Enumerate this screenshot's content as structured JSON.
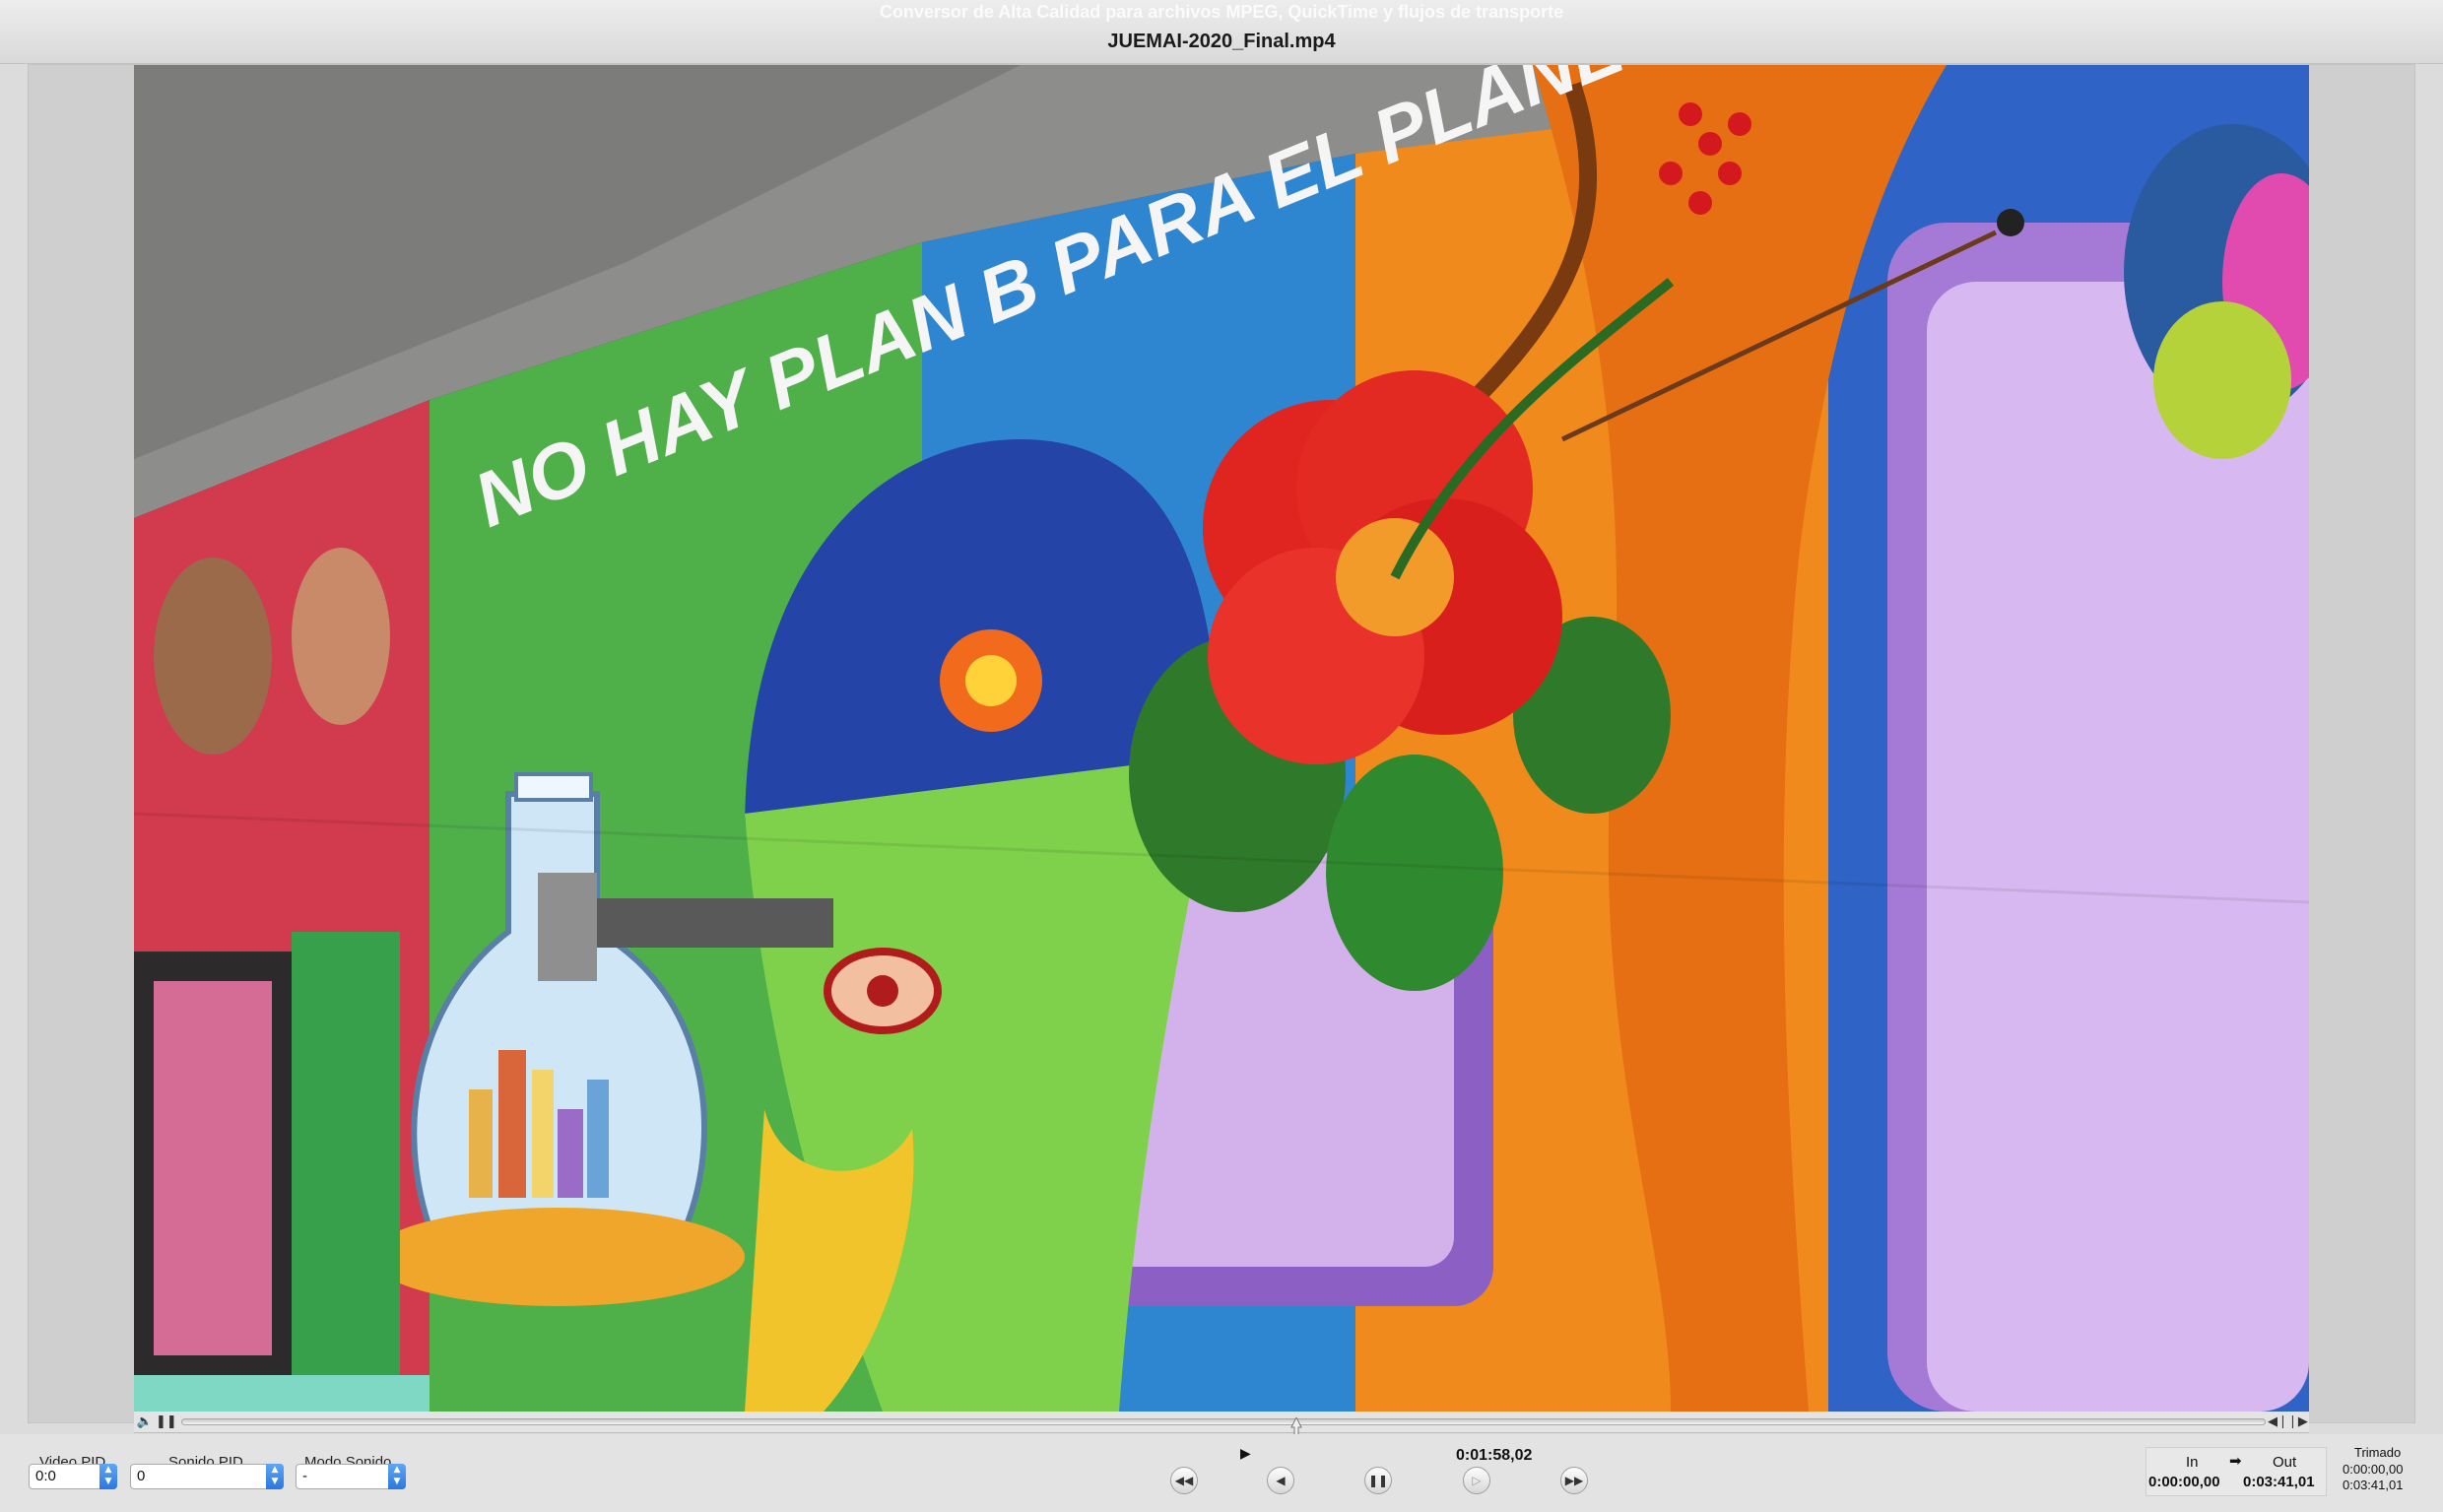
{
  "window": {
    "app_title": "Conversor de Alta Calidad para archivos MPEG, QuickTime y flujos de transporte",
    "file_title": "JUEMAI-2020_Final.mp4"
  },
  "video": {
    "mural_text": "NO HAY PLAN B PARA EL PLANETA"
  },
  "playback": {
    "progress": 0.535,
    "current_time": "0:01:58,02"
  },
  "fields": {
    "video_pid_label": "Video PID",
    "video_pid_value": "0:0",
    "sonido_pid_label": "Sonido PID",
    "sonido_pid_value": "0",
    "modo_sonido_label": "Modo Sonido",
    "modo_sonido_value": "-"
  },
  "inout": {
    "in_label": "In",
    "out_label": "Out",
    "in_value": "0:00:00,00",
    "out_value": "0:03:41,01",
    "trim_label": "Trimado",
    "trim_start": "0:00:00,00",
    "trim_end": "0:03:41,01"
  },
  "icons": {
    "arrow": "➡"
  }
}
